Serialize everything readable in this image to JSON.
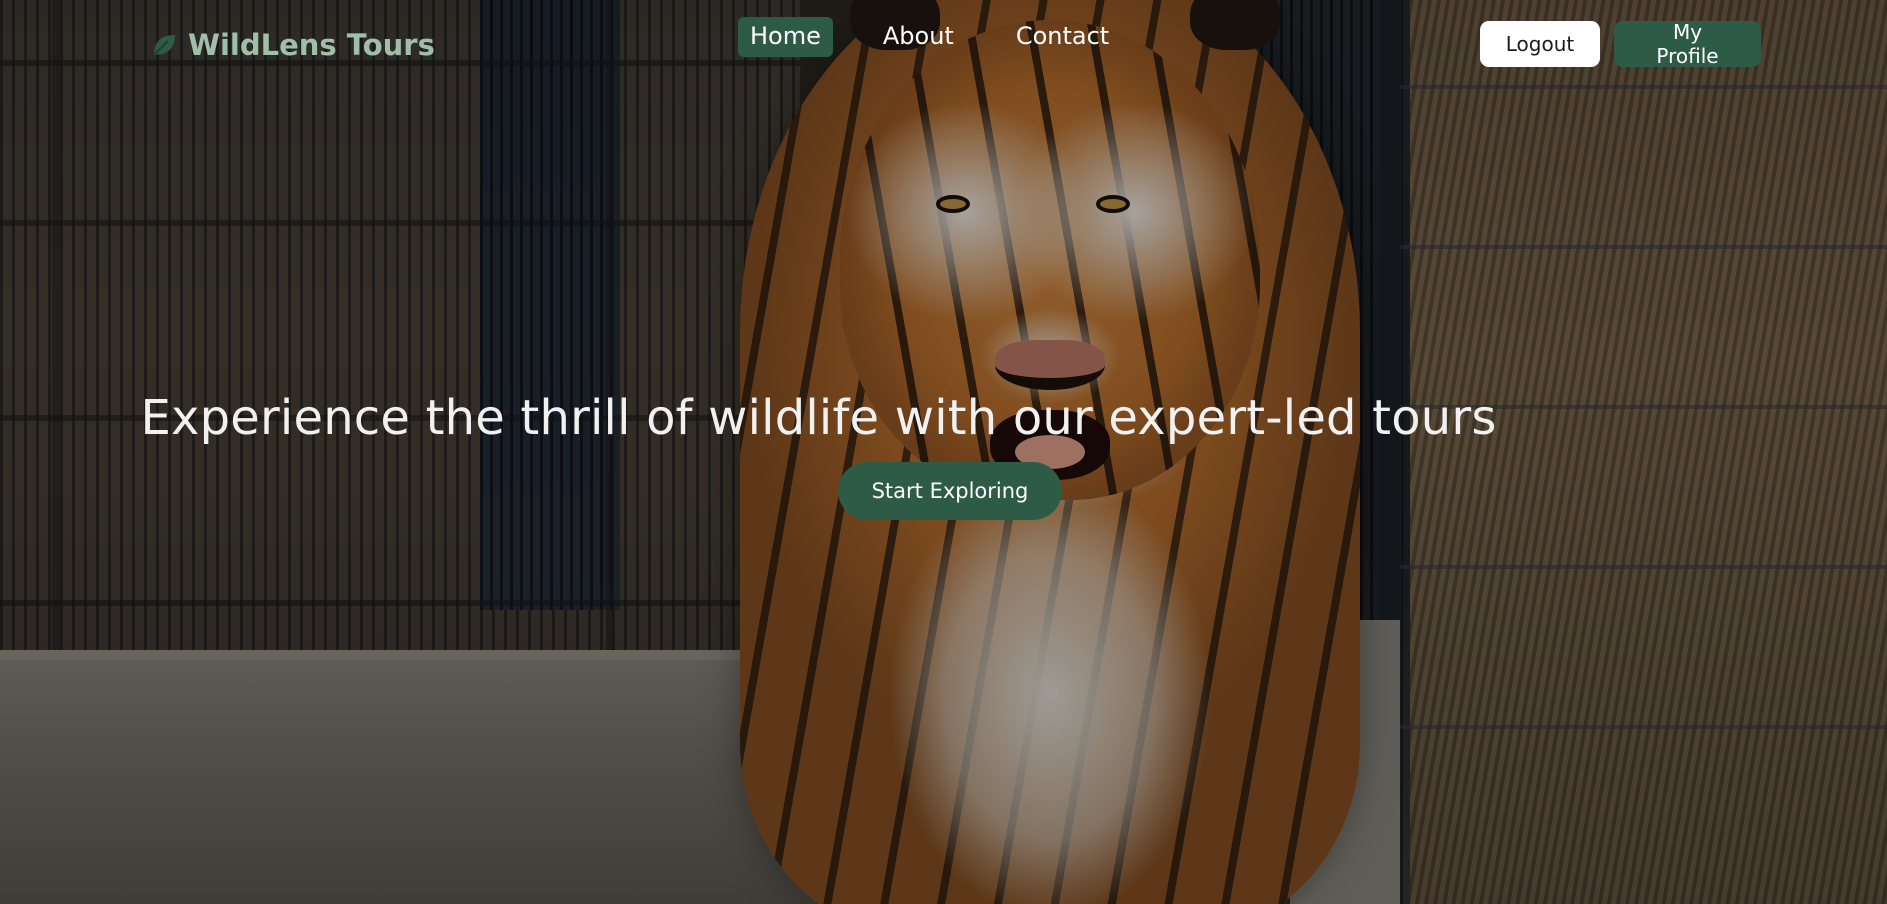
{
  "brand": {
    "name": "WildLens Tours",
    "icon": "leaf-icon",
    "color": "#9fc0a8"
  },
  "nav": {
    "items": [
      {
        "label": "Home",
        "active": true
      },
      {
        "label": "About",
        "active": false
      },
      {
        "label": "Contact",
        "active": false
      }
    ]
  },
  "auth": {
    "logout_label": "Logout",
    "profile_label": "My Profile"
  },
  "hero": {
    "headline": "Experience the thrill of wildlife with our expert-led tours",
    "cta_label": "Start Exploring",
    "background": "tiger walking in front of enclosure fence"
  },
  "colors": {
    "accent": "#2e5b45",
    "text": "#ffffff"
  }
}
